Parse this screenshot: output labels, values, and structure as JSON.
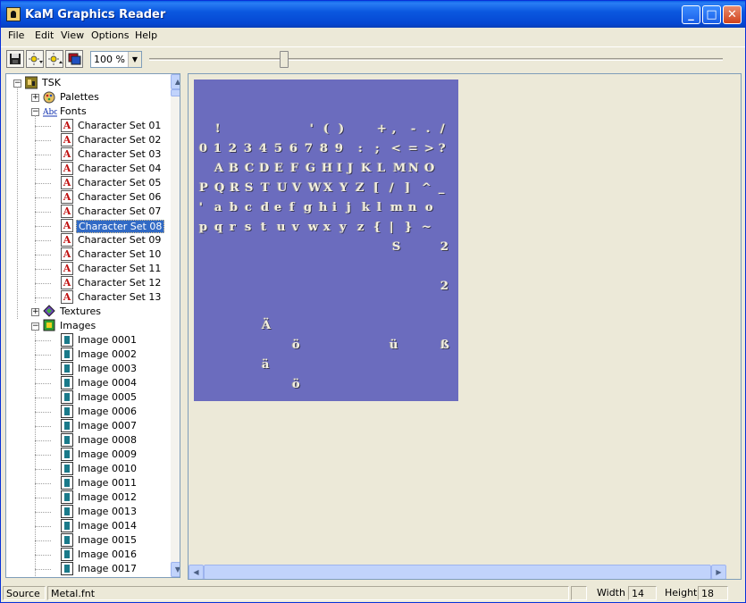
{
  "window": {
    "title": "KaM Graphics Reader",
    "minimize": "_",
    "maximize": "□",
    "close": "✕"
  },
  "menu": [
    "File",
    "Edit",
    "View",
    "Options",
    "Help"
  ],
  "toolbar": {
    "zoom": "100 %",
    "zoom_slider_percent": 23
  },
  "tree": {
    "root": "TSK",
    "palettes": "Palettes",
    "fonts": "Fonts",
    "font_items": [
      "Character Set 01",
      "Character Set 02",
      "Character Set 03",
      "Character Set 04",
      "Character Set 05",
      "Character Set 06",
      "Character Set 07",
      "Character Set 08",
      "Character Set 09",
      "Character Set 10",
      "Character Set 11",
      "Character Set 12",
      "Character Set 13"
    ],
    "selected_font": "Character Set 08",
    "textures": "Textures",
    "images": "Images",
    "image_items": [
      "Image 0001",
      "Image 0002",
      "Image 0003",
      "Image 0004",
      "Image 0005",
      "Image 0006",
      "Image 0007",
      "Image 0008",
      "Image 0009",
      "Image 0010",
      "Image 0011",
      "Image 0012",
      "Image 0013",
      "Image 0014",
      "Image 0015",
      "Image 0016",
      "Image 0017"
    ]
  },
  "font_sheet": {
    "background": "#6b6cbe",
    "rows": [
      "! ' ( ) + , - . /",
      "0 1 2 3 4 5 6 7 8 9 : ; < = > ?",
      "A B C D E F G H I J K L M N O",
      "P Q R S T U V W X Y Z [ / ] ^ _",
      "' a b c d e f g h i j k l m n o",
      "p q r s t u v w x y z { | } ~",
      "S 2",
      "2",
      "Ä",
      "ö ü ß",
      "ä",
      "ö"
    ]
  },
  "status": {
    "source_label": "Source",
    "source_value": "Metal.fnt",
    "width_label": "Width",
    "width_value": "14",
    "height_label": "Height",
    "height_value": "18"
  },
  "colors": {
    "titlebar": "#0547d2",
    "selection": "#316ac5",
    "canvas": "#6b6cbe"
  }
}
